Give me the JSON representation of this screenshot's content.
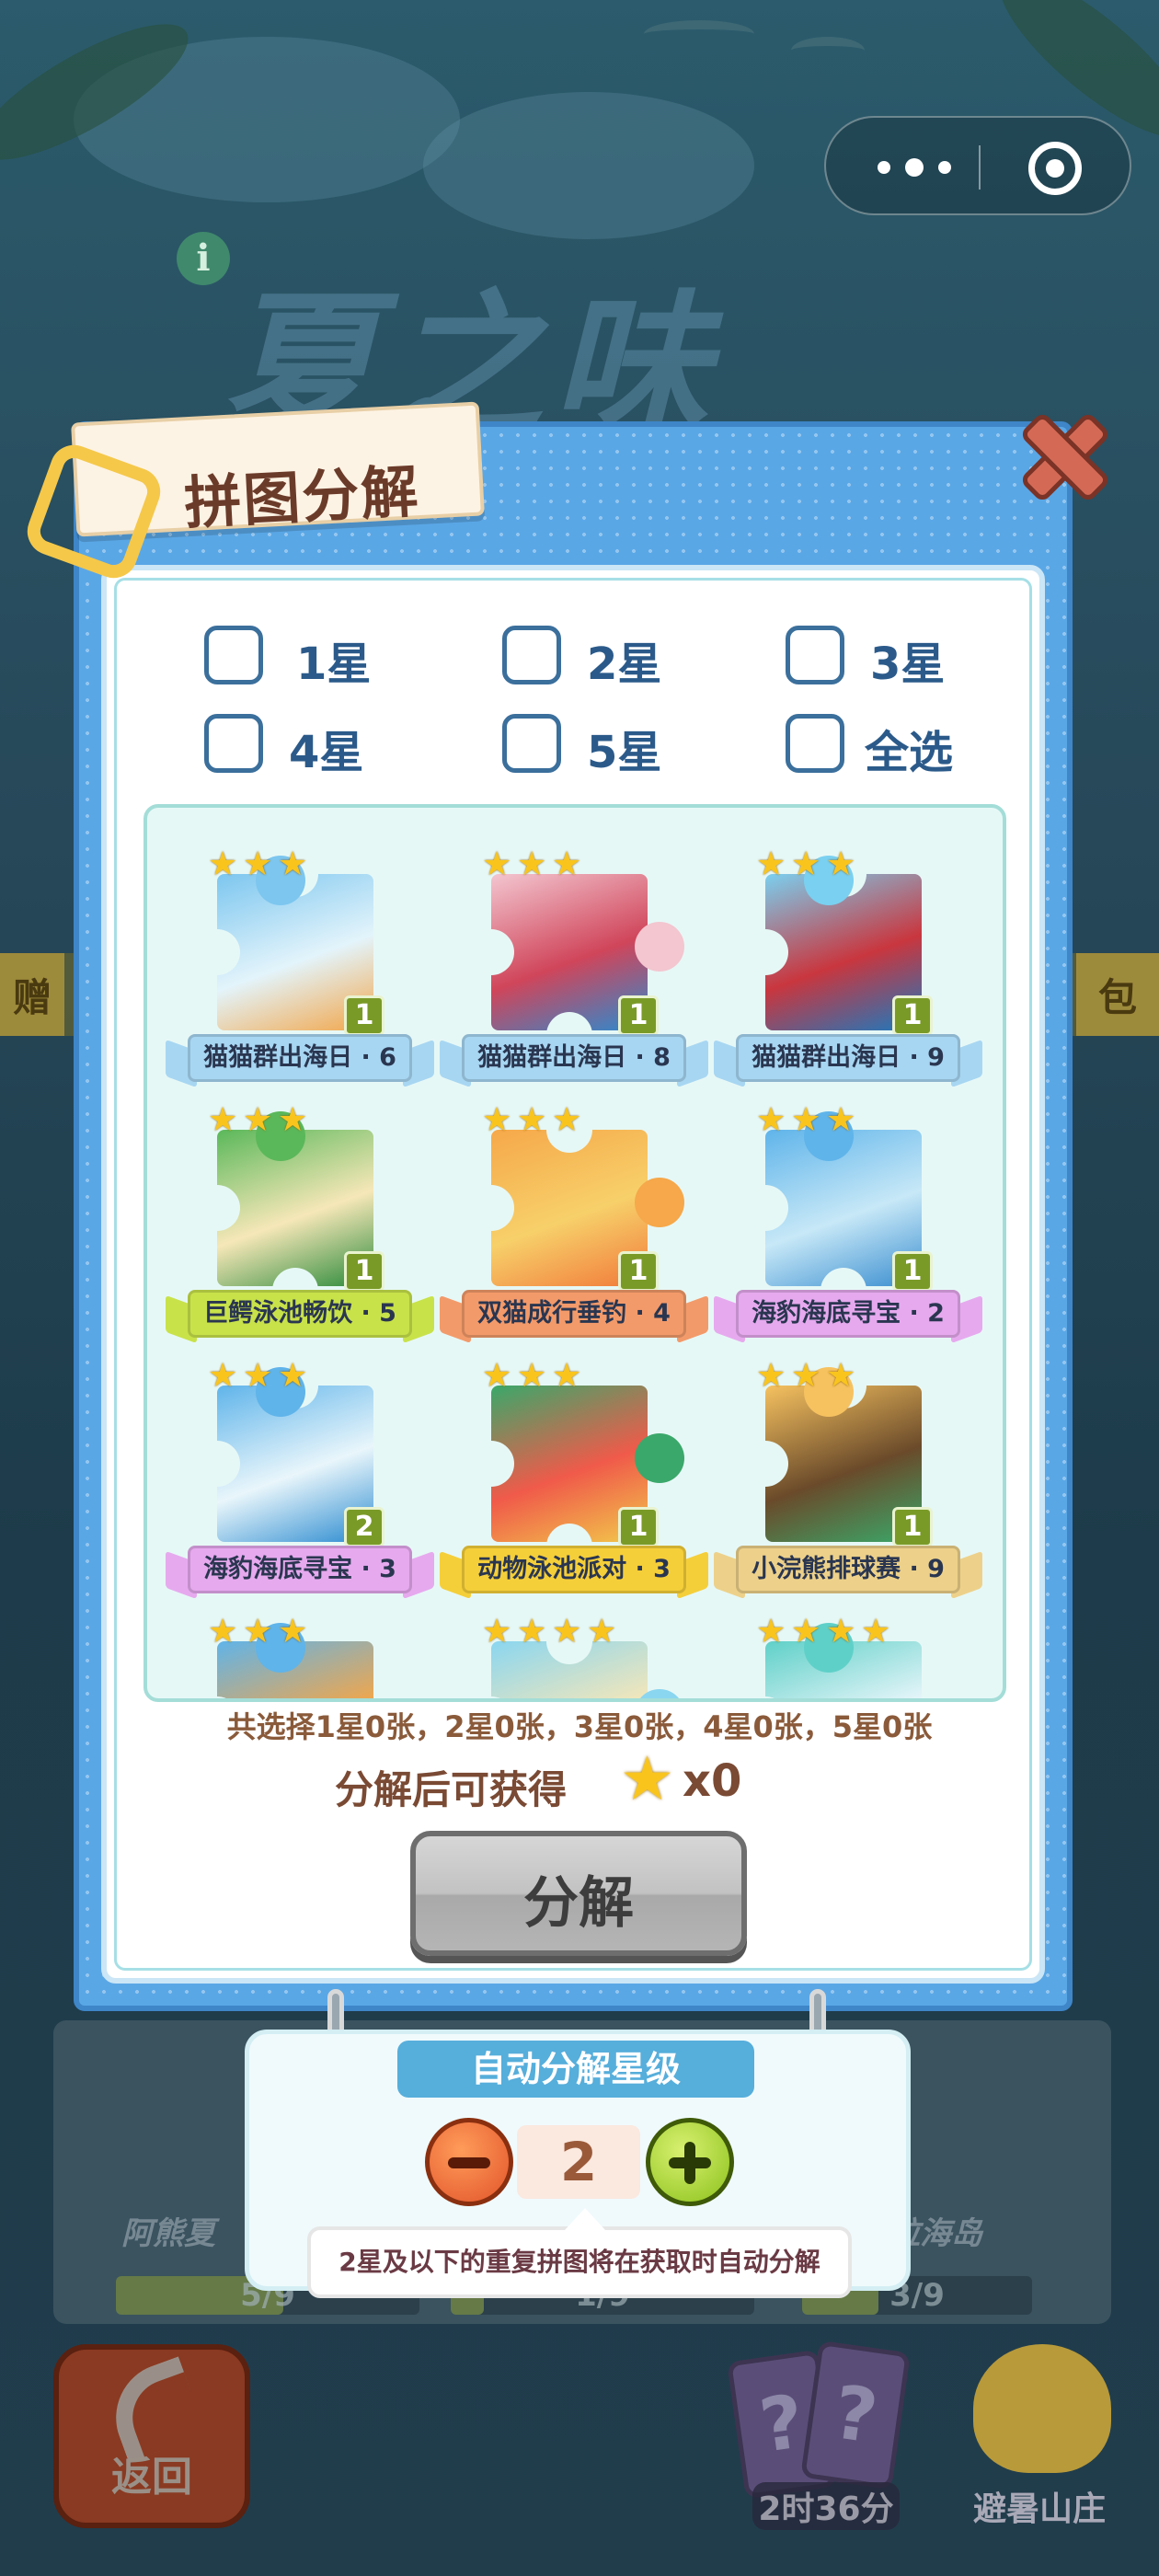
{
  "background": {
    "title": "夏之味",
    "strip_left": "赠",
    "strip_right": "包",
    "card_left": "阿熊夏",
    "card_right": "拉海岛",
    "progress_left": "5/9",
    "progress_mid": "1/9",
    "progress_right": "3/9",
    "back_label": "返回",
    "timer_label": "2时36分",
    "mountain_label": "避暑山庄"
  },
  "panel": {
    "title": "拼图分解",
    "filters": [
      "1星",
      "2星",
      "3星",
      "4星",
      "5星",
      "全选"
    ]
  },
  "puzzles": [
    {
      "name": "猫猫群出海日 · 6",
      "stars": 3,
      "count": 1,
      "ribbon": "#a7d6f2",
      "colors": [
        "#7cc6ef",
        "#e3f4fb",
        "#f2a64a"
      ]
    },
    {
      "name": "猫猫群出海日 · 8",
      "stars": 3,
      "count": 1,
      "ribbon": "#a7d6f2",
      "colors": [
        "#f3c6d0",
        "#d0455a",
        "#2a8bd0"
      ]
    },
    {
      "name": "猫猫群出海日 · 9",
      "stars": 3,
      "count": 1,
      "ribbon": "#a7d6f2",
      "colors": [
        "#7ad0f0",
        "#c9363e",
        "#1a7ac0"
      ]
    },
    {
      "name": "巨鳄泳池畅饮 · 5",
      "stars": 3,
      "count": 1,
      "ribbon": "#c8e24a",
      "colors": [
        "#5ab85a",
        "#f6e7b8",
        "#2b8a3a"
      ]
    },
    {
      "name": "双猫成行垂钓 · 4",
      "stars": 3,
      "count": 1,
      "ribbon": "#f39a6a",
      "colors": [
        "#f6a84a",
        "#f7d06a",
        "#f17a3a"
      ]
    },
    {
      "name": "海豹海底寻宝 · 2",
      "stars": 3,
      "count": 1,
      "ribbon": "#e6a9ee",
      "colors": [
        "#5fb4ea",
        "#c7e8f7",
        "#3a8ed0"
      ]
    },
    {
      "name": "海豹海底寻宝 · 3",
      "stars": 3,
      "count": 2,
      "ribbon": "#e6a9ee",
      "colors": [
        "#5fb4ea",
        "#e9f6fb",
        "#2b8bd0"
      ]
    },
    {
      "name": "动物泳池派对 · 3",
      "stars": 3,
      "count": 1,
      "ribbon": "#f5cf3a",
      "colors": [
        "#3aa86a",
        "#f05a4a",
        "#f2c94a"
      ]
    },
    {
      "name": "小浣熊排球赛 · 9",
      "stars": 3,
      "count": 1,
      "ribbon": "#edd18a",
      "colors": [
        "#f6c260",
        "#6a4a2a",
        "#3aa86a"
      ]
    },
    {
      "name": "",
      "stars": 3,
      "count": null,
      "ribbon": "",
      "colors": [
        "#5fb4ea",
        "#f2a64a",
        "#3aa8d0"
      ]
    },
    {
      "name": "",
      "stars": 4,
      "count": null,
      "ribbon": "",
      "colors": [
        "#8ad6f0",
        "#f6e7b8",
        "#d0455a"
      ]
    },
    {
      "name": "",
      "stars": 4,
      "count": null,
      "ribbon": "",
      "colors": [
        "#5fd0c8",
        "#e9f6fb",
        "#2b9bd0"
      ]
    }
  ],
  "summary": "共选择1星0张，2星0张，3星0张，4星0张，5星0张",
  "reward": {
    "label": "分解后可获得",
    "star_icon": "star-icon",
    "amount": "x0"
  },
  "decompose_button": "分解",
  "auto": {
    "title": "自动分解星级",
    "level": "2",
    "note": "2星及以下的重复拼图将在获取时自动分解"
  },
  "colors": {
    "panel_blue": "#5aa7e6",
    "star_yellow": "#f9c51d",
    "close_red": "#d46a56",
    "plus_green": "#8cc21c",
    "minus_orange": "#e2542a"
  }
}
